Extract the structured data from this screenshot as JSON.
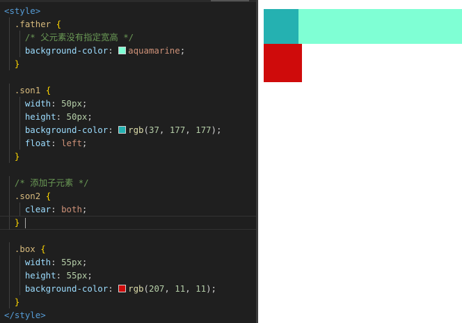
{
  "editor": {
    "lines": [
      [
        {
          "t": "<style>",
          "c": "tag"
        }
      ],
      [
        {
          "t": "  ",
          "c": "plain"
        },
        {
          "t": ".father",
          "c": "sel"
        },
        {
          "t": " ",
          "c": "plain"
        },
        {
          "t": "{",
          "c": "brace"
        }
      ],
      [
        {
          "t": "    ",
          "c": "plain"
        },
        {
          "t": "/* 父元素没有指定宽高 */",
          "c": "comment"
        }
      ],
      [
        {
          "t": "    ",
          "c": "plain"
        },
        {
          "t": "background-color",
          "c": "prop"
        },
        {
          "t": ": ",
          "c": "plain"
        },
        {
          "t": "",
          "c": "swatch",
          "color": "#7fffd4"
        },
        {
          "t": "aquamarine",
          "c": "val"
        },
        {
          "t": ";",
          "c": "plain"
        }
      ],
      [
        {
          "t": "  ",
          "c": "plain"
        },
        {
          "t": "}",
          "c": "brace"
        }
      ],
      [
        {
          "t": "",
          "c": "plain"
        }
      ],
      [
        {
          "t": "  ",
          "c": "plain"
        },
        {
          "t": ".son1",
          "c": "sel"
        },
        {
          "t": " ",
          "c": "plain"
        },
        {
          "t": "{",
          "c": "brace"
        }
      ],
      [
        {
          "t": "    ",
          "c": "plain"
        },
        {
          "t": "width",
          "c": "prop"
        },
        {
          "t": ": ",
          "c": "plain"
        },
        {
          "t": "50px",
          "c": "num"
        },
        {
          "t": ";",
          "c": "plain"
        }
      ],
      [
        {
          "t": "    ",
          "c": "plain"
        },
        {
          "t": "height",
          "c": "prop"
        },
        {
          "t": ": ",
          "c": "plain"
        },
        {
          "t": "50px",
          "c": "num"
        },
        {
          "t": ";",
          "c": "plain"
        }
      ],
      [
        {
          "t": "    ",
          "c": "plain"
        },
        {
          "t": "background-color",
          "c": "prop"
        },
        {
          "t": ": ",
          "c": "plain"
        },
        {
          "t": "",
          "c": "swatch",
          "color": "#25b1b1"
        },
        {
          "t": "rgb",
          "c": "fn"
        },
        {
          "t": "(",
          "c": "plain"
        },
        {
          "t": "37",
          "c": "num"
        },
        {
          "t": ", ",
          "c": "plain"
        },
        {
          "t": "177",
          "c": "num"
        },
        {
          "t": ", ",
          "c": "plain"
        },
        {
          "t": "177",
          "c": "num"
        },
        {
          "t": ");",
          "c": "plain"
        }
      ],
      [
        {
          "t": "    ",
          "c": "plain"
        },
        {
          "t": "float",
          "c": "prop"
        },
        {
          "t": ": ",
          "c": "plain"
        },
        {
          "t": "left",
          "c": "val"
        },
        {
          "t": ";",
          "c": "plain"
        }
      ],
      [
        {
          "t": "  ",
          "c": "plain"
        },
        {
          "t": "}",
          "c": "brace"
        }
      ],
      [
        {
          "t": "",
          "c": "plain"
        }
      ],
      [
        {
          "t": "  ",
          "c": "plain"
        },
        {
          "t": "/* 添加子元素 */",
          "c": "comment"
        }
      ],
      [
        {
          "t": "  ",
          "c": "plain"
        },
        {
          "t": ".son2",
          "c": "sel"
        },
        {
          "t": " ",
          "c": "plain"
        },
        {
          "t": "{",
          "c": "brace"
        }
      ],
      [
        {
          "t": "    ",
          "c": "plain"
        },
        {
          "t": "clear",
          "c": "prop"
        },
        {
          "t": ": ",
          "c": "plain"
        },
        {
          "t": "both",
          "c": "val"
        },
        {
          "t": ";",
          "c": "plain"
        }
      ],
      [
        {
          "t": "  ",
          "c": "plain"
        },
        {
          "t": "}",
          "c": "brace"
        }
      ],
      [
        {
          "t": "",
          "c": "plain"
        }
      ],
      [
        {
          "t": "  ",
          "c": "plain"
        },
        {
          "t": ".box",
          "c": "sel"
        },
        {
          "t": " ",
          "c": "plain"
        },
        {
          "t": "{",
          "c": "brace"
        }
      ],
      [
        {
          "t": "    ",
          "c": "plain"
        },
        {
          "t": "width",
          "c": "prop"
        },
        {
          "t": ": ",
          "c": "plain"
        },
        {
          "t": "55px",
          "c": "num"
        },
        {
          "t": ";",
          "c": "plain"
        }
      ],
      [
        {
          "t": "    ",
          "c": "plain"
        },
        {
          "t": "height",
          "c": "prop"
        },
        {
          "t": ": ",
          "c": "plain"
        },
        {
          "t": "55px",
          "c": "num"
        },
        {
          "t": ";",
          "c": "plain"
        }
      ],
      [
        {
          "t": "    ",
          "c": "plain"
        },
        {
          "t": "background-color",
          "c": "prop"
        },
        {
          "t": ": ",
          "c": "plain"
        },
        {
          "t": "",
          "c": "swatch",
          "color": "#cf0b0b"
        },
        {
          "t": "rgb",
          "c": "fn"
        },
        {
          "t": "(",
          "c": "plain"
        },
        {
          "t": "207",
          "c": "num"
        },
        {
          "t": ", ",
          "c": "plain"
        },
        {
          "t": "11",
          "c": "num"
        },
        {
          "t": ", ",
          "c": "plain"
        },
        {
          "t": "11",
          "c": "num"
        },
        {
          "t": ");",
          "c": "plain"
        }
      ],
      [
        {
          "t": "  ",
          "c": "plain"
        },
        {
          "t": "}",
          "c": "brace"
        }
      ],
      [
        {
          "t": "</style>",
          "c": "tag"
        }
      ]
    ],
    "current_line": 16
  },
  "preview": {
    "father_color": "#7fffd4",
    "son1_color": "#25b1b1",
    "box_color": "#cf0b0b"
  }
}
